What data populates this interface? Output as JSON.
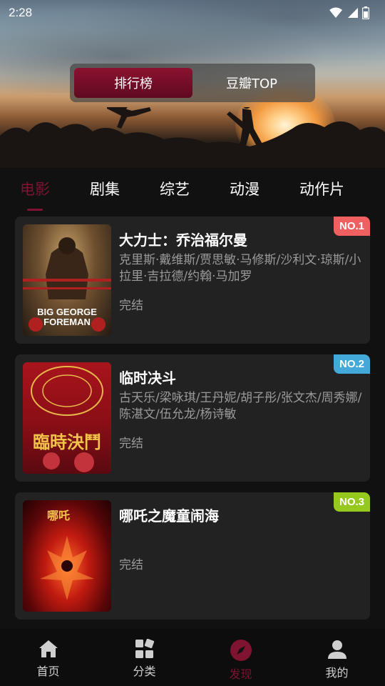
{
  "status_bar": {
    "time": "2:28",
    "icons": [
      "wifi-icon",
      "signal-icon",
      "battery-icon"
    ]
  },
  "segment": {
    "tabs": [
      "排行榜",
      "豆瓣TOP"
    ],
    "active_index": 0
  },
  "categories": {
    "items": [
      "电影",
      "剧集",
      "综艺",
      "动漫",
      "动作片"
    ],
    "active_index": 0
  },
  "ranking": [
    {
      "rank": "NO.1",
      "title": "大力士：乔治福尔曼",
      "cast": "克里斯·戴维斯/贾思敏·马修斯/沙利文·琼斯/小拉里·吉拉德/约翰·马加罗",
      "status": "完结",
      "poster_text": "BIG GEORGE FOREMAN",
      "badge_color": "#f06060"
    },
    {
      "rank": "NO.2",
      "title": "临时决斗",
      "cast": "古天乐/梁咏琪/王丹妮/胡子彤/张文杰/周秀娜/陈湛文/伍允龙/杨诗敏",
      "status": "完结",
      "poster_text": "臨時決鬥",
      "badge_color": "#42a9d8"
    },
    {
      "rank": "NO.3",
      "title": "哪吒之魔童闹海",
      "cast": "",
      "status": "完结",
      "poster_text": "哪吒",
      "badge_color": "#97c81e"
    }
  ],
  "bottom_nav": {
    "items": [
      {
        "label": "首页",
        "icon": "home-icon"
      },
      {
        "label": "分类",
        "icon": "category-icon"
      },
      {
        "label": "发现",
        "icon": "compass-icon"
      },
      {
        "label": "我的",
        "icon": "user-icon"
      }
    ],
    "active_index": 2
  },
  "colors": {
    "accent": "#7e1430",
    "card_bg": "#222222",
    "background": "#111111"
  }
}
